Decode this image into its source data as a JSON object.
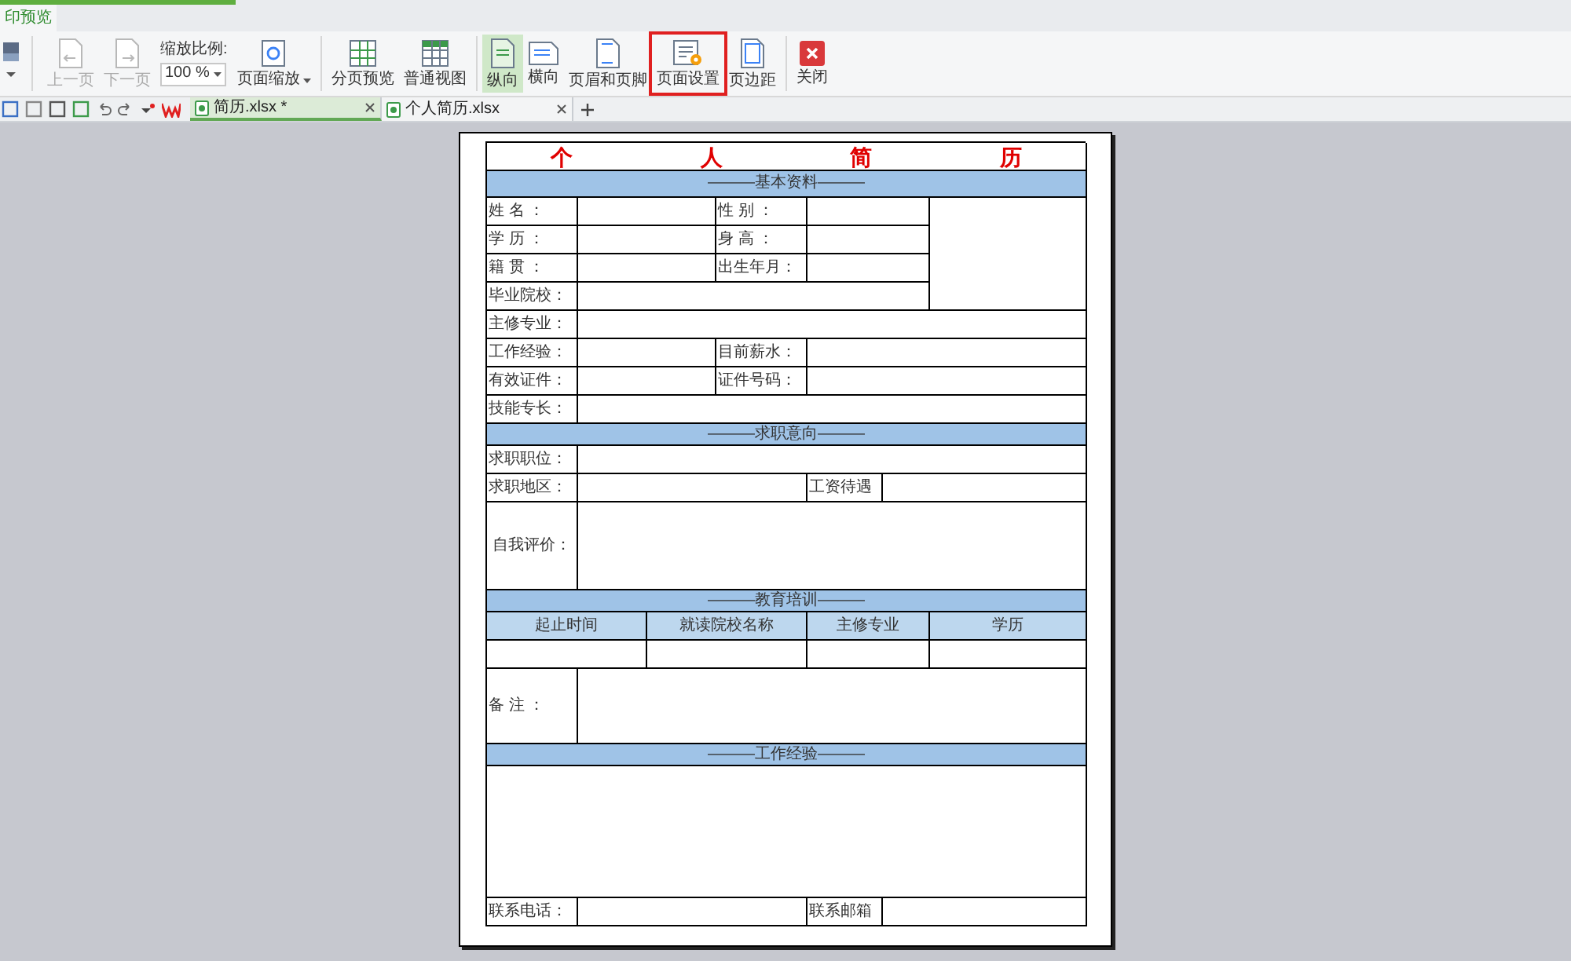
{
  "ribbon_tab": {
    "label": "印预览",
    "selected": true
  },
  "toolbar": [
    {
      "kind": "button",
      "label": "上一页",
      "disabled": true
    },
    {
      "kind": "button",
      "label": "下一页",
      "disabled": true
    },
    {
      "kind": "combo",
      "label": "缩放比例:",
      "value": "100 %"
    },
    {
      "kind": "menu",
      "label": "页面缩放",
      "disabled": false
    },
    {
      "kind": "sep"
    },
    {
      "kind": "button",
      "label": "分页预览",
      "disabled": false
    },
    {
      "kind": "button",
      "label": "普通视图",
      "disabled": false
    },
    {
      "kind": "sep"
    },
    {
      "kind": "toggle",
      "label": "纵向",
      "selected": true
    },
    {
      "kind": "toggle",
      "label": "横向",
      "selected": false
    },
    {
      "kind": "button",
      "label": "页眉和页脚",
      "disabled": false
    },
    {
      "kind": "button",
      "label": "页面设置",
      "disabled": false,
      "highlighted": true
    },
    {
      "kind": "button",
      "label": "页边距",
      "disabled": false
    },
    {
      "kind": "sep"
    },
    {
      "kind": "button",
      "label": "关闭",
      "disabled": false
    }
  ],
  "doc_tabs": [
    {
      "label": "简历.xlsx *",
      "selected": true
    },
    {
      "label": "个人简历.xlsx",
      "selected": false
    }
  ],
  "resume": {
    "title": [
      "个",
      "人",
      "简",
      "历"
    ],
    "sections": [
      "———基本资料———",
      "———求职意向———",
      "———教育培训———",
      "———工作经验———"
    ],
    "basic_labels": [
      "姓 名 ：",
      "性 别 ：",
      "学 历 ：",
      "身 高 ：",
      "籍 贯 ：",
      "出生年月：",
      "毕业院校：",
      "主修专业：",
      "工作经验：",
      "目前薪水：",
      "有效证件：",
      "证件号码：",
      "技能专长："
    ],
    "intent_labels": [
      "求职职位：",
      "求职地区：",
      "工资待遇",
      "自我评价："
    ],
    "education_headers": [
      "起止时间",
      "就读院校名称",
      "主修专业",
      "学历"
    ],
    "remark_label": "备 注 ：",
    "contact_labels": [
      "联系电话：",
      "联系邮箱"
    ]
  }
}
